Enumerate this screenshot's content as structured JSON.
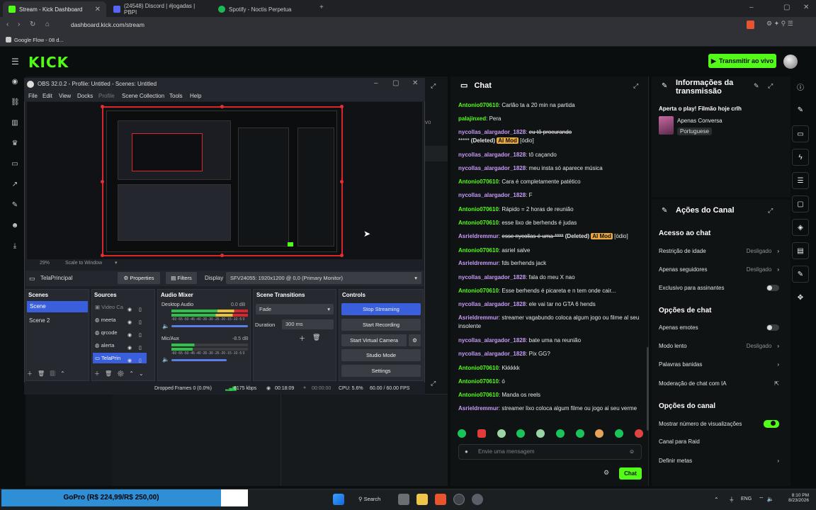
{
  "browser": {
    "tabs": [
      {
        "title": "Stream - Kick Dashboard"
      },
      {
        "title": "(24548) Discord | #jogadas | PBPI"
      },
      {
        "title": "Spotify - Noctis Perpetua"
      }
    ],
    "url": "dashboard.kick.com/stream",
    "bookmark": "Google Flow - 08 d..."
  },
  "kick": {
    "logo": "KICK",
    "golive_label": "Transmitir ao vivo",
    "stream_label_partial": "vo"
  },
  "obs": {
    "title": "OBS 32.0.2 - Profile: Untitled - Scenes: Untitled",
    "menu": [
      "File",
      "Edit",
      "View",
      "Docks",
      "Profile",
      "Scene Collection",
      "Tools",
      "Help"
    ],
    "zoom": "29%",
    "scale_mode": "Scale to Window",
    "source_name": "TelaPrincipal",
    "properties_label": "Properties",
    "filters_label": "Filters",
    "display_label": "Display",
    "display_value": "SFV24055: 1920x1200 @ 0,0 (Primary Monitor)",
    "scenes_header": "Scenes",
    "scenes": [
      "Scene",
      "Scene 2"
    ],
    "sources_header": "Sources",
    "sources": [
      "Video Ca",
      "meeta",
      "qrcode",
      "alerta",
      "TelaPrin"
    ],
    "mixer_header": "Audio Mixer",
    "mixer": [
      {
        "name": "Desktop Audio",
        "db": "0.0 dB"
      },
      {
        "name": "Mic/Aux",
        "db": "-8.5 dB"
      }
    ],
    "meter_scale": "-60 -55 -50 -45 -40 -35 -30 -25 -20 -15 -10 -5 0",
    "transitions_header": "Scene Transitions",
    "transition": "Fade",
    "duration_label": "Duration",
    "duration_value": "300 ms",
    "controls_header": "Controls",
    "controls": [
      "Stop Streaming",
      "Start Recording",
      "Start Virtual Camera",
      "Studio Mode",
      "Settings"
    ],
    "status": {
      "dropped": "Dropped Frames 0 (0.0%)",
      "kbps": "6175 kbps",
      "live_time": "00:18:09",
      "rec_time": "00:00:00",
      "cpu": "CPU: 5.6%",
      "fps": "60.00 / 60.00 FPS"
    }
  },
  "chat": {
    "title": "Chat",
    "messages": [
      {
        "user": "Antonio070610",
        "color": "g",
        "text": "Carlão ta a 20 min na partida"
      },
      {
        "user": "palajinxed",
        "color": "g",
        "text": "Pera"
      },
      {
        "user": "nycollas_alargador_1828",
        "color": "p",
        "text": "eu tô procurando",
        "strike": true,
        "extra": "*****",
        "deleted": "(Deleted)",
        "badge": "AI Mod",
        "reason": "[ódio]"
      },
      {
        "user": "nycollas_alargador_1828",
        "color": "p",
        "text": "tô caçando"
      },
      {
        "user": "nycollas_alargador_1828",
        "color": "p",
        "text": "meu insta só aparece música"
      },
      {
        "user": "Antonio070610",
        "color": "g",
        "text": "Cara é completamente patético"
      },
      {
        "user": "nycollas_alargador_1828",
        "color": "p",
        "text": "F"
      },
      {
        "user": "Antonio070610",
        "color": "g",
        "text": "Rápido = 2 horas de reunião"
      },
      {
        "user": "Antonio070610",
        "color": "g",
        "text": "esse lixo de berhends é judas"
      },
      {
        "user": "Asrieldremmur",
        "color": "p",
        "text": "esse nycollas é uma ****",
        "strike": true,
        "deleted": "(Deleted)",
        "badge": "AI Mod",
        "reason": "[ódio]"
      },
      {
        "user": "Antonio070610",
        "color": "g",
        "text": "asriel salve"
      },
      {
        "user": "Asrieldremmur",
        "color": "p",
        "text": "fds berhends jack"
      },
      {
        "user": "nycollas_alargador_1828",
        "color": "p",
        "text": "fala do meu X nao"
      },
      {
        "user": "Antonio070610",
        "color": "g",
        "text": "Esse berhends é picareta e n tem onde cair..."
      },
      {
        "user": "nycollas_alargador_1828",
        "color": "p",
        "text": "ele vai tar no GTA 6 hends"
      },
      {
        "user": "Asrieldremmur",
        "color": "p",
        "text": "streamer vagabundo coloca algum jogo ou filme al seu insolente"
      },
      {
        "user": "nycollas_alargador_1828",
        "color": "p",
        "text": "bate uma na reunião"
      },
      {
        "user": "nycollas_alargador_1828",
        "color": "p",
        "text": "Pix GG?"
      },
      {
        "user": "Antonio070610",
        "color": "g",
        "text": "Kkkkkk"
      },
      {
        "user": "Antonio070610",
        "color": "g",
        "text": "ó"
      },
      {
        "user": "Antonio070610",
        "color": "g",
        "text": "Manda os reels"
      },
      {
        "user": "Asrieldremmur",
        "color": "p",
        "text": "streamer lixo coloca algum filme ou jogo ai seu verme"
      }
    ],
    "input_placeholder": "Envie uma mensagem",
    "send_label": "Chat"
  },
  "info": {
    "title": "Informações da transmissão",
    "stream_title": "Aperta o play! Filmão hoje crlh",
    "category": "Apenas Conversa",
    "language": "Portuguese"
  },
  "actions": {
    "title": "Ações do Canal",
    "chat_access": "Acesso ao chat",
    "age_restriction": {
      "label": "Restrição de idade",
      "value": "Desligado"
    },
    "followers_only": {
      "label": "Apenas seguidores",
      "value": "Desligado"
    },
    "subs_only": {
      "label": "Exclusivo para assinantes"
    },
    "chat_options": "Opções de chat",
    "emotes_only": {
      "label": "Apenas emotes"
    },
    "slow_mode": {
      "label": "Modo lento",
      "value": "Desligado"
    },
    "banned_words": {
      "label": "Palavras banidas"
    },
    "ai_moderation": {
      "label": "Moderação de chat com IA"
    },
    "channel_options": "Opções do canal",
    "show_views": {
      "label": "Mostrar número de visualizações"
    },
    "raid": {
      "label": "Canal para Raid"
    },
    "goals": {
      "label": "Definir metas"
    }
  },
  "taskbar": {
    "widget": "GoPro (R$ 224,99/R$ 250,00)",
    "search": "Search",
    "lang": "ENG",
    "time": "8:10 PM",
    "date": "8/23/2026"
  }
}
